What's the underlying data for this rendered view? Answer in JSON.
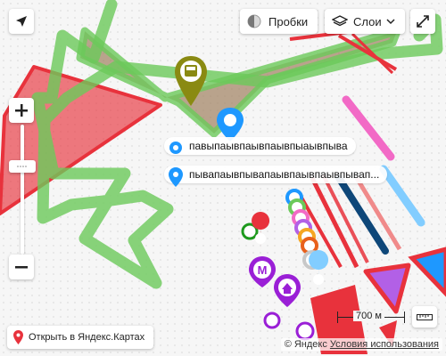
{
  "toolbar": {
    "traffic_label": "Пробки",
    "layers_label": "Слои"
  },
  "placemarks": [
    {
      "label": "павыпаывпаывпаывпыаывпыва"
    },
    {
      "label": "пывапаывпывапаывпаывпаывпывап..."
    }
  ],
  "scale": {
    "label": "700 м"
  },
  "open_in_maps": {
    "label": "Открыть в Яндекс.Картах"
  },
  "copyright": {
    "brand": "© Яндекс",
    "terms": "Условия использования"
  },
  "colors": {
    "green_route": "#6cc95a",
    "brown_polygon": "#a08060",
    "red_polygon": "#e8323c",
    "purple": "#9a1fd6",
    "blue_pin": "#1e98ff",
    "olive_pin": "#8a8a12",
    "pink_line": "#f26ac6",
    "navy_line": "#0e4779",
    "light_blue_line": "#82cdff"
  },
  "icons": [
    "geolocation-icon",
    "zoom-in-icon",
    "zoom-out-icon",
    "traffic-icon",
    "layers-icon",
    "chevron-down-icon",
    "fullscreen-icon",
    "ruler-icon",
    "bus-icon",
    "metro-icon",
    "home-icon",
    "yandex-pin-icon"
  ]
}
